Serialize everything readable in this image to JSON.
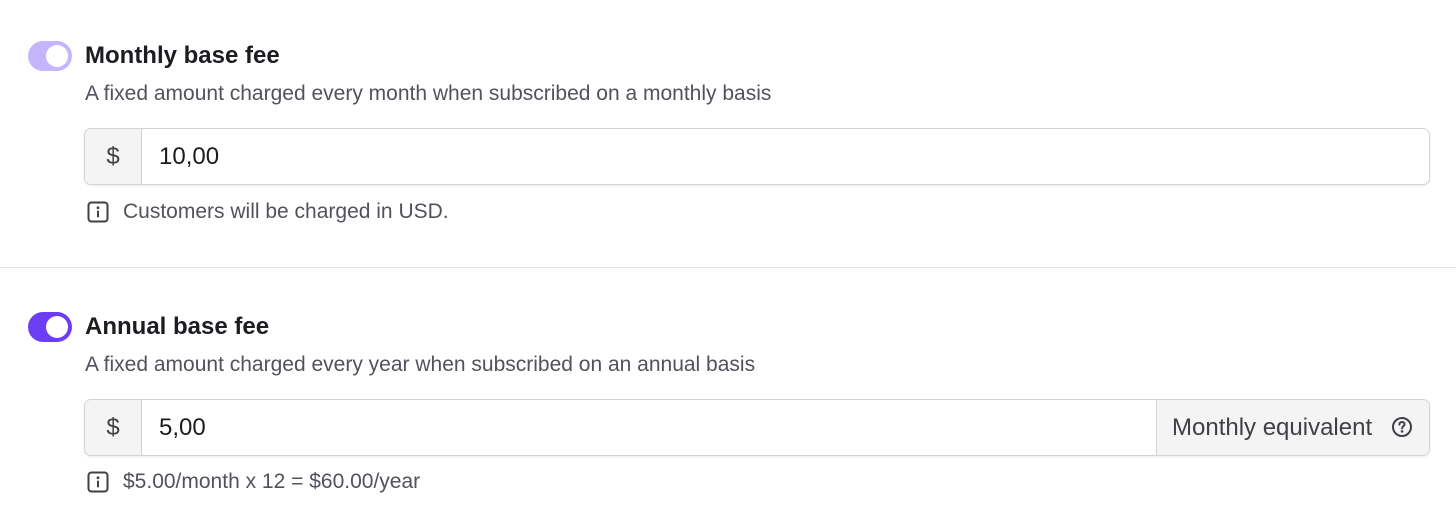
{
  "monthly": {
    "enabled": true,
    "title": "Monthly base fee",
    "description": "A fixed amount charged every month when subscribed on a monthly basis",
    "currency_symbol": "$",
    "amount": "10,00",
    "hint": "Customers will be charged in USD.",
    "hint_icon": "info-icon"
  },
  "annual": {
    "enabled": true,
    "title": "Annual base fee",
    "description": "A fixed amount charged every year when subscribed on an annual basis",
    "currency_symbol": "$",
    "amount": "5,00",
    "suffix_label": "Monthly equivalent",
    "suffix_icon": "help-icon",
    "hint": "$5.00/month x 12 = $60.00/year",
    "hint_icon": "info-icon"
  },
  "colors": {
    "toggle_monthly": "#c4b5fd",
    "toggle_annual": "#6d3df5"
  }
}
